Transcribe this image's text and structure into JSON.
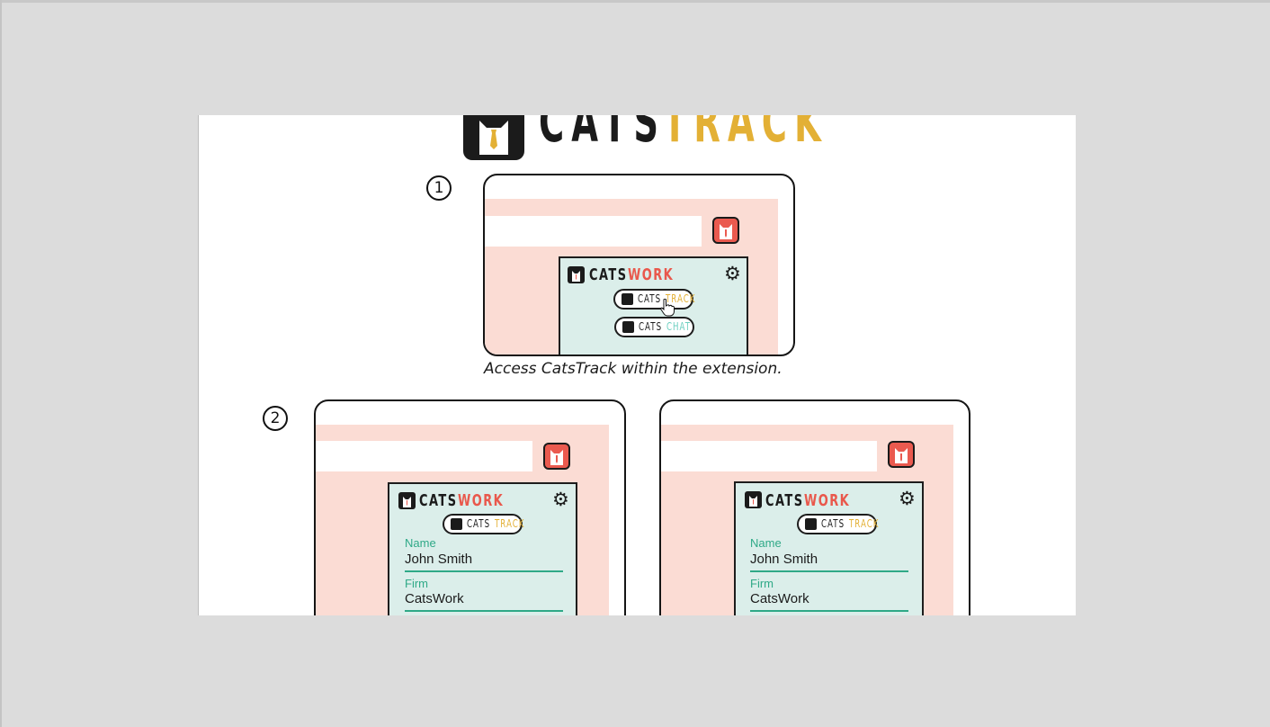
{
  "header_logo": {
    "word1": "CATS",
    "word2": "TRACK",
    "cats_color": "#1b1b1b",
    "track_color": "#e3b035"
  },
  "steps": [
    "1",
    "2"
  ],
  "step1": {
    "popup_brand_word1": "CATS",
    "popup_brand_word2": "WORK",
    "buttons": [
      {
        "word1": "CATS",
        "word2": "TRACK"
      },
      {
        "word1": "CATS",
        "word2": "CHAT"
      }
    ],
    "caption": "Access CatsTrack within the extension."
  },
  "step2": {
    "panels": [
      {
        "brand_word1": "CATS",
        "brand_word2": "WORK",
        "pill_word1": "CATS",
        "pill_word2": "TRACK",
        "fields": [
          {
            "label": "Name",
            "value": "John Smith"
          },
          {
            "label": "Firm",
            "value": "CatsWork"
          }
        ]
      },
      {
        "brand_word1": "CATS",
        "brand_word2": "WORK",
        "pill_word1": "CATS",
        "pill_word2": "TRACK",
        "fields": [
          {
            "label": "Name",
            "value": "John Smith"
          },
          {
            "label": "Firm",
            "value": "CatsWork"
          }
        ]
      }
    ]
  },
  "colors": {
    "work": "#e9584c",
    "track": "#e3b035",
    "chat": "#6ccfc0",
    "field_accent": "#2fa987",
    "browser_bg": "#fbdcd4",
    "popup_bg": "#dbeeea"
  },
  "icons": [
    "cat-logo-icon",
    "gear-icon",
    "pointer-hand-icon",
    "cat-extension-icon"
  ]
}
